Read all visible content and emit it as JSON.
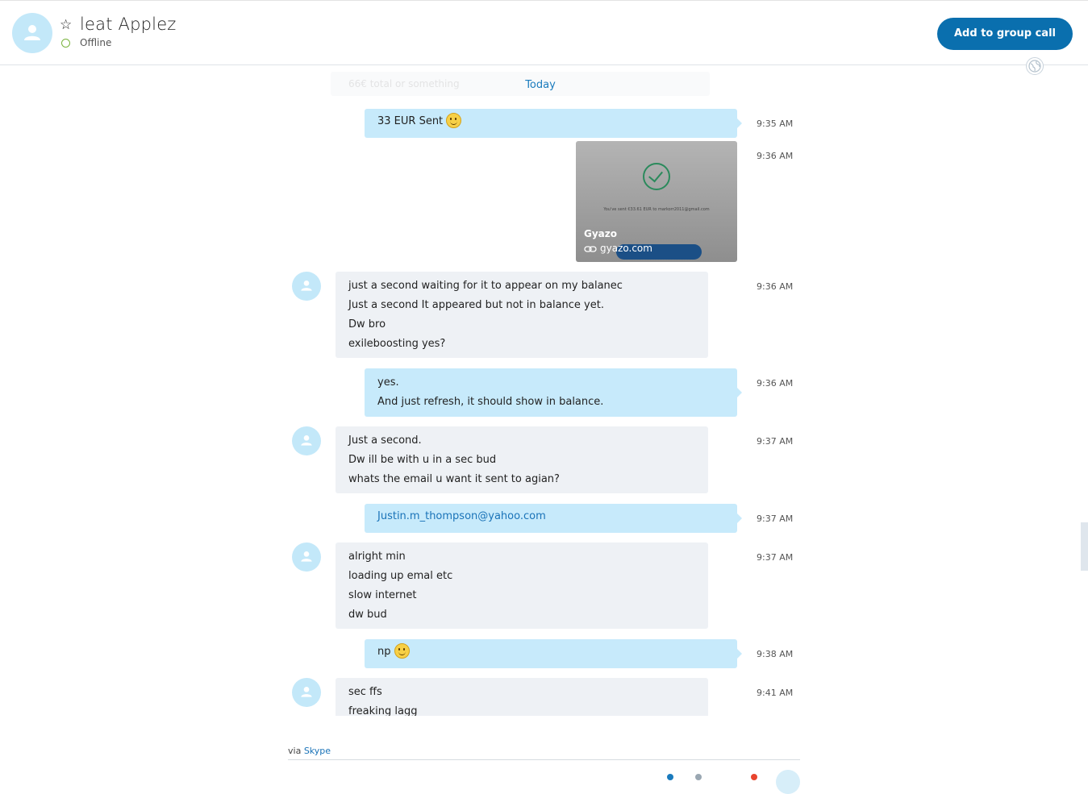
{
  "header": {
    "contact_name": "leat Applez",
    "status": "Offline",
    "add_group_call_label": "Add to group call"
  },
  "chat": {
    "faded_text": "66€ total or something",
    "date_divider": "Today",
    "messages": [
      {
        "dir": "out",
        "lines": [
          "33 EUR Sent"
        ],
        "emoji": true,
        "time": "9:35 AM"
      },
      {
        "dir": "out",
        "type": "link-preview",
        "site": "Gyazo",
        "url": "gyazo.com",
        "inner_text": "You've sent €33.61 EUR to markorr2011@gmail.com",
        "time": "9:36 AM"
      },
      {
        "dir": "in",
        "lines": [
          "just a second waiting for it to appear on my balanec",
          "Just a second It appeared but not in balance yet.",
          "Dw bro",
          "exileboosting yes?"
        ],
        "time": "9:36 AM"
      },
      {
        "dir": "out",
        "lines": [
          "yes.",
          "And just refresh, it should show in balance."
        ],
        "time": "9:36 AM"
      },
      {
        "dir": "in",
        "lines": [
          "Just a second.",
          "Dw ill be with u in a sec bud",
          "whats the email u want it sent to agian?"
        ],
        "time": "9:37 AM"
      },
      {
        "dir": "out",
        "lines": [
          "Justin.m_thompson@yahoo.com"
        ],
        "is_link": true,
        "time": "9:37 AM"
      },
      {
        "dir": "in",
        "lines": [
          "alright min",
          "loading up emal etc",
          "slow internet",
          "dw bud"
        ],
        "time": "9:37 AM"
      },
      {
        "dir": "out",
        "lines": [
          "np"
        ],
        "emoji": true,
        "time": "9:38 AM"
      },
      {
        "dir": "in",
        "lines": [
          "sec ffs",
          "freaking lagg"
        ],
        "time": "9:41 AM"
      }
    ]
  },
  "footer": {
    "via_prefix": "via",
    "via_link": "Skype"
  },
  "colors": {
    "accent": "#0a6fae",
    "outgoing_bubble": "#c7eafb",
    "incoming_bubble": "#eef1f5",
    "online_ring": "#7ab33e"
  },
  "icons": {
    "avatar": "person-icon",
    "favorite": "star-icon",
    "status": "status-ring-icon",
    "globe": "globe-icon",
    "link": "link-icon",
    "emoji": "smiley-icon"
  }
}
